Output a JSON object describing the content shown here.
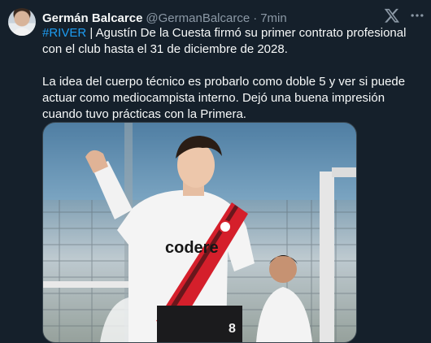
{
  "author": {
    "name": "Germán Balcarce",
    "handle": "@GermanBalcarce",
    "separator": "·",
    "time": "7min"
  },
  "tweet": {
    "hashtag": "#RIVER",
    "line1_rest": " | Agustín De la Cuesta firmó su primer contrato profesional con el club hasta el 31 de diciembre de 2028.",
    "paragraph2": "La idea del cuerpo técnico es probarlo como doble 5 y ver si puede actuar como mediocampista interno. Dejó una buena impresión cuando tuvo prácticas con la Primera."
  },
  "media": {
    "jersey_sponsor": "codere",
    "jersey_number": "8"
  },
  "icons": {
    "brand": "x-logo-icon",
    "menu": "more-options-icon"
  },
  "colors": {
    "background": "#15202b",
    "text": "#f7f9f9",
    "secondary_text": "#8b98a5",
    "link": "#1d9bf0",
    "jersey_sash": "#d51f2b"
  }
}
